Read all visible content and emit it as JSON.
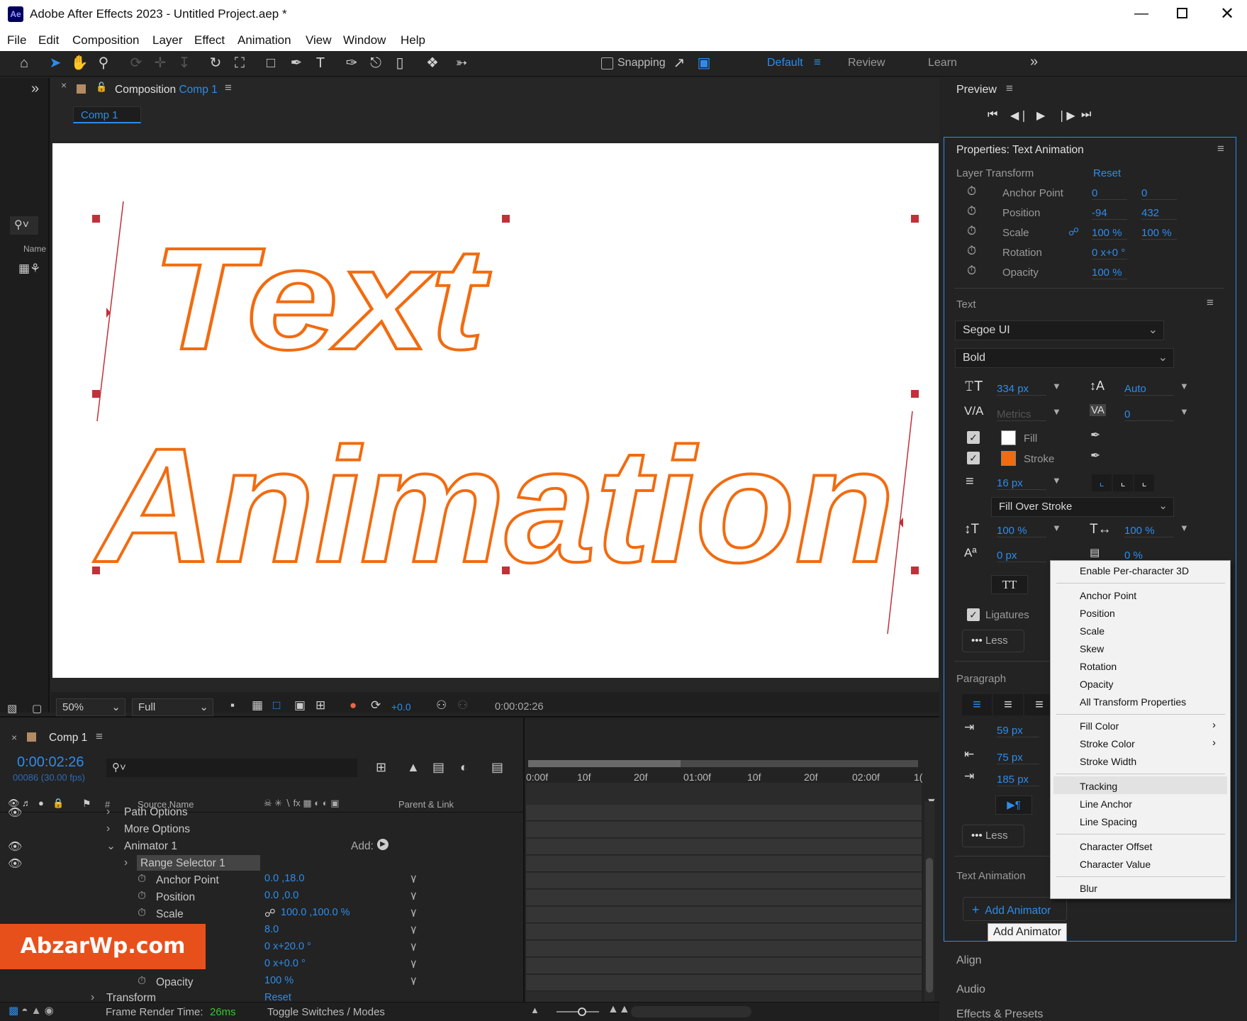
{
  "app": {
    "title": "Adobe After Effects 2023 - Untitled Project.aep *",
    "logo": "Ae"
  },
  "menubar": [
    "File",
    "Edit",
    "Composition",
    "Layer",
    "Effect",
    "Animation",
    "View",
    "Window",
    "Help"
  ],
  "toolbar": {
    "snapping_label": "Snapping",
    "workspaces": [
      "Default",
      "Review",
      "Learn"
    ]
  },
  "comp_panel": {
    "header_prefix": "Composition",
    "header_comp": "Comp 1",
    "tab": "Comp 1",
    "zoom": "50%",
    "resolution": "Full",
    "exposure": "+0.0",
    "timecode": "0:00:02:26",
    "text_line1": "Text",
    "text_line2": "Animation"
  },
  "project_panel": {
    "name_col": "Name"
  },
  "preview": {
    "title": "Preview"
  },
  "properties": {
    "title": "Properties: Text Animation",
    "layer_transform": "Layer Transform",
    "reset": "Reset",
    "rows": [
      {
        "label": "Anchor Point",
        "v1": "0",
        "v2": "0"
      },
      {
        "label": "Position",
        "v1": "-94",
        "v2": "432"
      },
      {
        "label": "Scale",
        "v1": "100 %",
        "v2": "100 %"
      },
      {
        "label": "Rotation",
        "v1": "0 x+0 °",
        "v2": ""
      },
      {
        "label": "Opacity",
        "v1": "100 %",
        "v2": ""
      }
    ],
    "text_section": "Text",
    "font": "Segoe UI",
    "style": "Bold",
    "font_size": "334 px",
    "leading": "Auto",
    "kerning": "Metrics",
    "tracking": "0",
    "fill": "Fill",
    "stroke": "Stroke",
    "stroke_width": "16 px",
    "stroke_mode": "Fill Over Stroke",
    "vscale": "100 %",
    "hscale": "100 %",
    "baseline": "0 px",
    "tsume": "0 %",
    "tt": "TT",
    "ligatures": "Ligatures",
    "less": "Less",
    "paragraph": "Paragraph",
    "indent1": "59 px",
    "indent2": "75 px",
    "indent3": "185 px",
    "less2": "Less",
    "text_animation": "Text Animation",
    "add_animator": "Add Animator",
    "tooltip": "Add Animator",
    "align": "Align",
    "audio": "Audio",
    "effects": "Effects & Presets",
    "fill_color": "#ffffff",
    "stroke_color": "#f26b0f"
  },
  "context_menu": {
    "groups": [
      [
        "Enable Per-character 3D"
      ],
      [
        "Anchor Point",
        "Position",
        "Scale",
        "Skew",
        "Rotation",
        "Opacity",
        "All Transform Properties"
      ],
      [
        "Fill Color",
        "Stroke Color",
        "Stroke Width"
      ],
      [
        "Tracking",
        "Line Anchor",
        "Line Spacing"
      ],
      [
        "Character Offset",
        "Character Value"
      ],
      [
        "Blur"
      ]
    ],
    "highlighted": "Tracking"
  },
  "timeline": {
    "tab": "Comp 1",
    "time": "0:00:02:26",
    "fps": "00086 (30.00 fps)",
    "col_source": "Source Name",
    "col_parent": "Parent & Link",
    "ruler": [
      "0:00f",
      "10f",
      "20f",
      "01:00f",
      "10f",
      "20f",
      "02:00f",
      "1("
    ],
    "rows": [
      {
        "name": "Path Options",
        "value": ""
      },
      {
        "name": "More Options",
        "value": ""
      },
      {
        "name": "Animator 1",
        "value": "Add:"
      },
      {
        "name": "Range Selector 1",
        "value": ""
      },
      {
        "name": "Anchor Point",
        "value": "0.0 ,18.0"
      },
      {
        "name": "Position",
        "value": "0.0 ,0.0"
      },
      {
        "name": "Scale",
        "value": "100.0 ,100.0 %"
      },
      {
        "name": "",
        "value": "8.0"
      },
      {
        "name": "",
        "value": "0 x+20.0 °"
      },
      {
        "name": "",
        "value": "0 x+0.0 °"
      },
      {
        "name": "Opacity",
        "value": "100 %"
      },
      {
        "name": "Transform",
        "value": "Reset"
      }
    ],
    "render_label": "Frame Render Time:",
    "render_value": "26ms",
    "toggle": "Toggle Switches / Modes"
  },
  "watermark": "AbzarWp.com",
  "colors": {
    "accent": "#2d8ceb",
    "stroke_orange": "#f26b0f",
    "watermark_bg": "#e8501b",
    "handle": "#c0313a"
  }
}
